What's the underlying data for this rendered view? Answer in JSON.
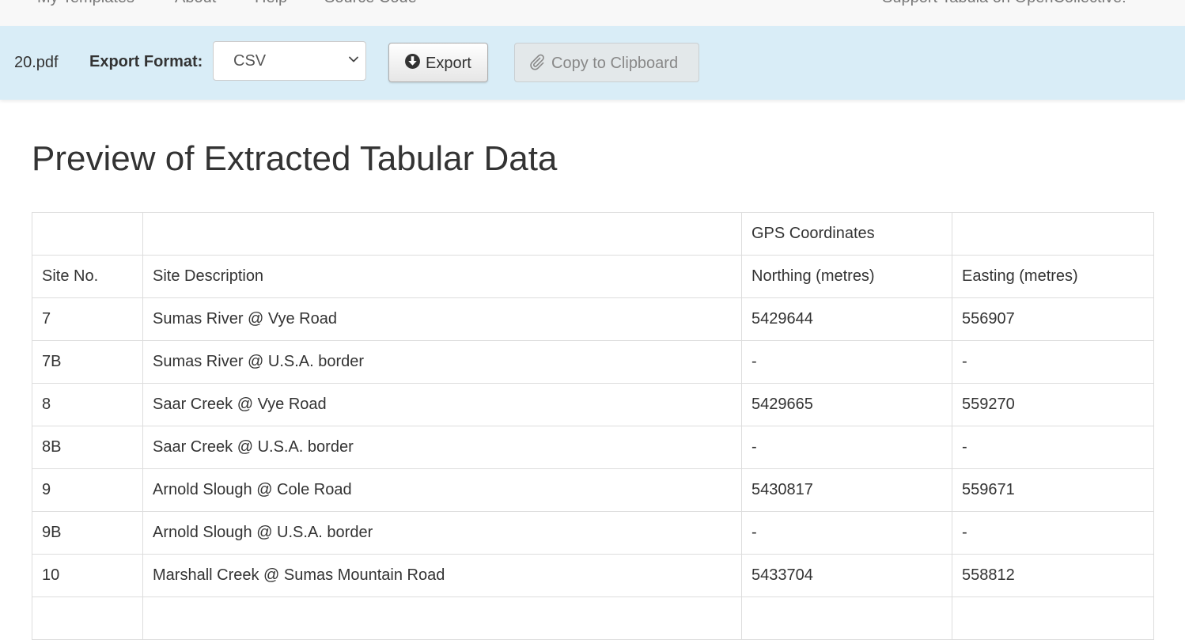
{
  "top_nav": {
    "items": [
      "My Templates",
      "About",
      "Help",
      "Source Code"
    ],
    "right_link": "Support Tabula on OpenCollective!"
  },
  "toolbar": {
    "filename": "20.pdf",
    "format_label": "Export Format:",
    "format_value": "CSV",
    "export_label": "Export",
    "copy_label": "Copy to Clipboard"
  },
  "main": {
    "title": "Preview of Extracted Tabular Data"
  },
  "table": {
    "rows": [
      [
        "",
        "",
        "GPS Coordinates",
        ""
      ],
      [
        "Site No.",
        "Site Description",
        "Northing (metres)",
        "Easting (metres)"
      ],
      [
        "7",
        "Sumas River @ Vye Road",
        "5429644",
        "556907"
      ],
      [
        "7B",
        "Sumas River @ U.S.A. border",
        "-",
        "-"
      ],
      [
        "8",
        "Saar Creek @ Vye Road",
        "5429665",
        "559270"
      ],
      [
        "8B",
        "Saar Creek @ U.S.A. border",
        "-",
        "-"
      ],
      [
        "9",
        "Arnold Slough @ Cole Road",
        "5430817",
        "559671"
      ],
      [
        "9B",
        "Arnold Slough @ U.S.A. border",
        "-",
        "-"
      ],
      [
        "10",
        "Marshall Creek @ Sumas Mountain Road",
        "5433704",
        "558812"
      ],
      [
        "",
        "",
        "",
        ""
      ]
    ]
  },
  "colors": {
    "toolbar_bg": "#d9edf7",
    "nav_bg": "#f8f8f8",
    "text": "#333333",
    "border": "#dddddd"
  }
}
